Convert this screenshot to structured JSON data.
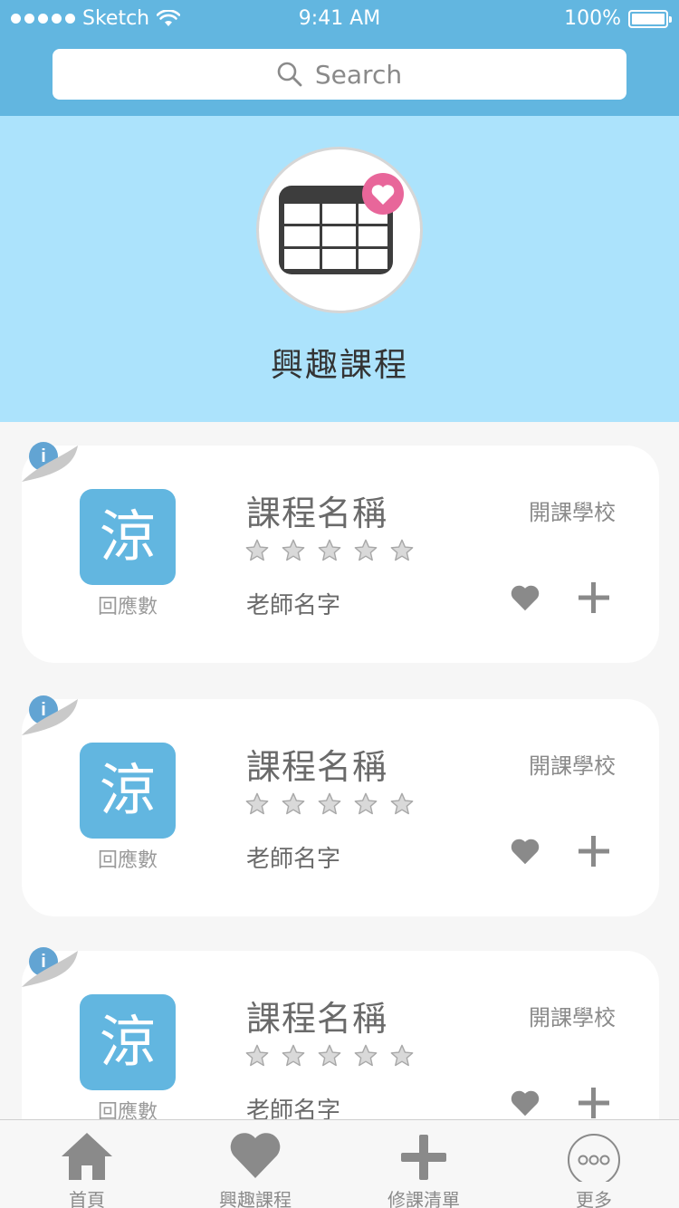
{
  "status_bar": {
    "carrier": "Sketch",
    "time": "9:41 AM",
    "battery": "100%"
  },
  "search": {
    "placeholder": "Search"
  },
  "hero": {
    "title": "興趣課程",
    "icon": "calendar-heart-icon"
  },
  "courses": [
    {
      "icon_char": "涼",
      "reply_label": "回應數",
      "name": "課程名稱",
      "school": "開課學校",
      "teacher": "老師名字",
      "rating": 0,
      "rating_max": 5
    },
    {
      "icon_char": "涼",
      "reply_label": "回應數",
      "name": "課程名稱",
      "school": "開課學校",
      "teacher": "老師名字",
      "rating": 0,
      "rating_max": 5
    },
    {
      "icon_char": "涼",
      "reply_label": "回應數",
      "name": "課程名稱",
      "school": "開課學校",
      "teacher": "老師名字",
      "rating": 0,
      "rating_max": 5
    }
  ],
  "tabbar": {
    "tabs": [
      {
        "label": "首頁",
        "icon": "home-icon"
      },
      {
        "label": "興趣課程",
        "icon": "heart-icon"
      },
      {
        "label": "修課清單",
        "icon": "plus-icon"
      },
      {
        "label": "更多",
        "icon": "more-icon"
      }
    ]
  },
  "colors": {
    "header": "#62b6e0",
    "hero": "#ace3fc",
    "accent_pink": "#e8669a",
    "icon_gray": "#8a8a8a"
  }
}
